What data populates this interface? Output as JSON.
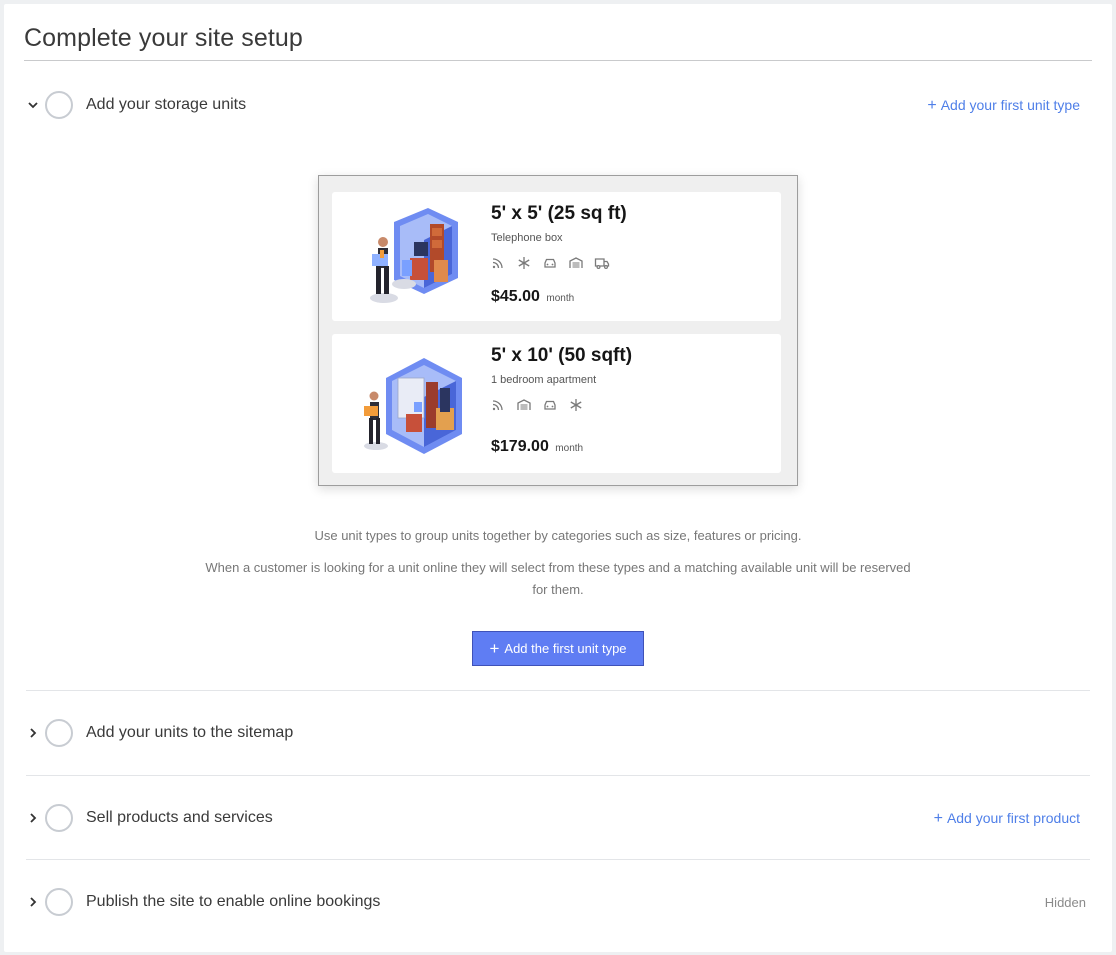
{
  "page": {
    "title": "Complete your site setup"
  },
  "steps": [
    {
      "label": "Add your storage units",
      "action": "Add your first unit type",
      "expanded": true
    },
    {
      "label": "Add your units to the sitemap",
      "expanded": false
    },
    {
      "label": "Sell products and services",
      "action": "Add your first product",
      "expanded": false
    },
    {
      "label": "Publish the site to enable online bookings",
      "status": "Hidden",
      "expanded": false
    }
  ],
  "preview": {
    "units": [
      {
        "name": "5' x 5' (25 sq ft)",
        "description": "Telephone box",
        "features": [
          "rss-icon",
          "snowflake-icon",
          "car-icon",
          "garage-icon",
          "truck-icon"
        ],
        "price": "$45.00",
        "period": "month"
      },
      {
        "name": "5' x 10' (50 sqft)",
        "description": "1 bedroom apartment",
        "features": [
          "rss-icon",
          "garage-icon",
          "car-icon",
          "snowflake-icon"
        ],
        "price": "$179.00",
        "period": "month"
      }
    ]
  },
  "info": {
    "line1": "Use unit types to group units together by categories such as size, features or pricing.",
    "line2": "When a customer is looking for a unit online they will select from these types and a matching available unit will be reserved for them."
  },
  "primary_button": {
    "label": "Add the first unit type"
  },
  "colors": {
    "accent": "#4f7fe8",
    "button": "#5f7df3",
    "circle": "#c8ccd2"
  }
}
